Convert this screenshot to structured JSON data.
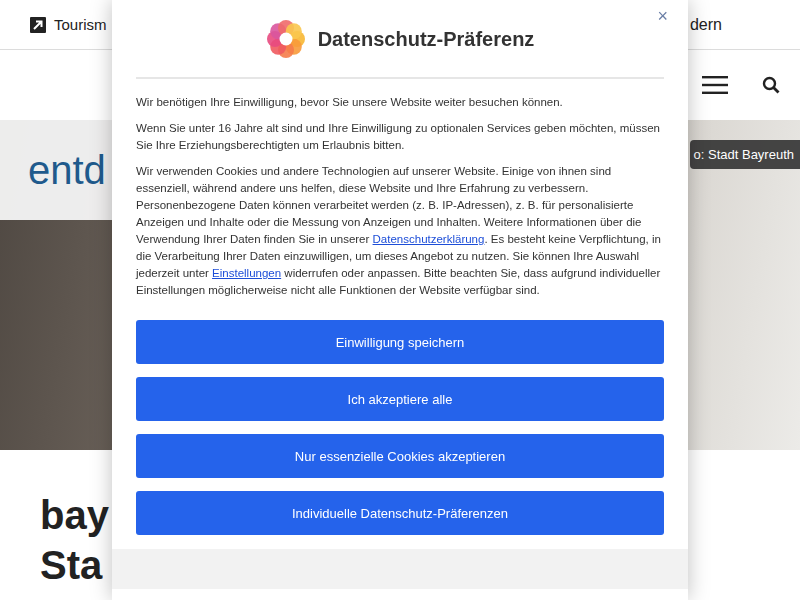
{
  "header": {
    "top_link": "Tourism",
    "right_link": "dern"
  },
  "hero": {
    "title": "entd",
    "photo_credit": "o: Stadt Bayreuth"
  },
  "page_heading": [
    "bay",
    "Sta"
  ],
  "dialog": {
    "title": "Datenschutz-Präferenz",
    "close": "×",
    "paragraphs": [
      [
        {
          "text": "Wir benötigen Ihre Einwilligung, bevor Sie unsere Website weiter besuchen können.",
          "link": false
        }
      ],
      [
        {
          "text": "Wenn Sie unter 16 Jahre alt sind und Ihre Einwilligung zu optionalen Services geben möchten, müssen Sie Ihre Erziehungsberechtigten um Erlaubnis bitten.",
          "link": false
        }
      ],
      [
        {
          "text": "Wir verwenden Cookies und andere Technologien auf unserer Website. Einige von ihnen sind essenziell, während andere uns helfen, diese Website und Ihre Erfahrung zu verbessern. Personenbezogene Daten können verarbeitet werden (z. B. IP-Adressen), z. B. für personalisierte Anzeigen und Inhalte oder die Messung von Anzeigen und Inhalten. Weitere Informationen über die Verwendung Ihrer Daten finden Sie in unserer ",
          "link": false
        },
        {
          "text": "Datenschutzerklärung",
          "link": true
        },
        {
          "text": ". Es besteht keine Verpflichtung, in die Verarbeitung Ihrer Daten einzuwilligen, um dieses Angebot zu nutzen. Sie können Ihre Auswahl jederzeit unter ",
          "link": false
        },
        {
          "text": "Einstellungen",
          "link": true
        },
        {
          "text": " widerrufen oder anpassen. Bitte beachten Sie, dass aufgrund individueller Einstellungen möglicherweise nicht alle Funktionen der Website verfügbar sind.",
          "link": false
        }
      ]
    ],
    "buttons": [
      "Einwilligung speichern",
      "Ich akzeptiere alle",
      "Nur essenzielle Cookies akzeptieren",
      "Individuelle Datenschutz-Präferenzen"
    ]
  }
}
